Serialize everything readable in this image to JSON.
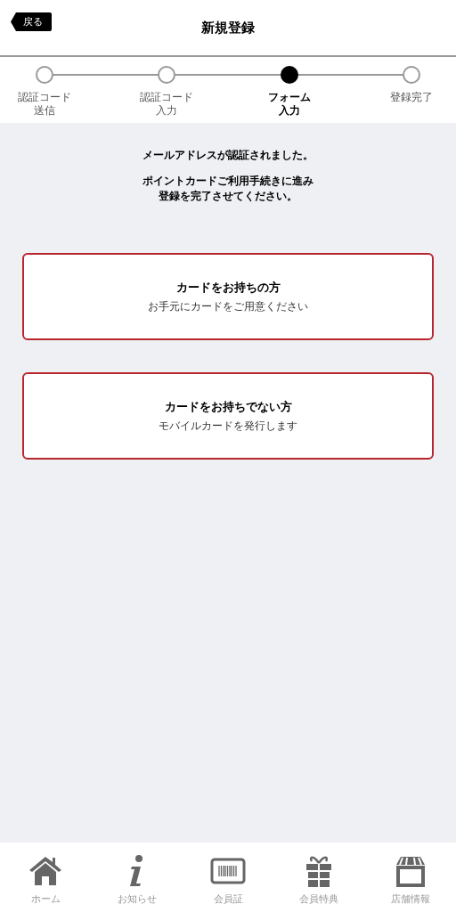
{
  "header": {
    "back_button": "戻る",
    "title": "新規登録"
  },
  "steps": [
    {
      "lines": [
        "認証コード",
        "送信"
      ],
      "selected": false
    },
    {
      "lines": [
        "認証コード",
        "入力"
      ],
      "selected": false
    },
    {
      "lines": [
        "フォーム",
        "入力"
      ],
      "selected": true
    },
    {
      "lines": [
        "登録完了"
      ],
      "selected": false
    }
  ],
  "messages": [
    "メールアドレスが認証されました。",
    [
      "ポイントカードご利用手続きに進み",
      "登録を完了させてください。"
    ]
  ],
  "options": [
    {
      "title": "カードをお持ちの方",
      "subtitle": "お手元にカードをご用意ください"
    },
    {
      "title": "カードをお持ちでない方",
      "subtitle": "モバイルカードを発行します"
    }
  ],
  "tab_bar": [
    {
      "kind": "home",
      "label": "ホーム"
    },
    {
      "kind": "info",
      "label": "お知らせ"
    },
    {
      "kind": "card",
      "label": "会員証"
    },
    {
      "kind": "gift",
      "label": "会員特典"
    },
    {
      "kind": "store",
      "label": "店舗情報"
    }
  ]
}
